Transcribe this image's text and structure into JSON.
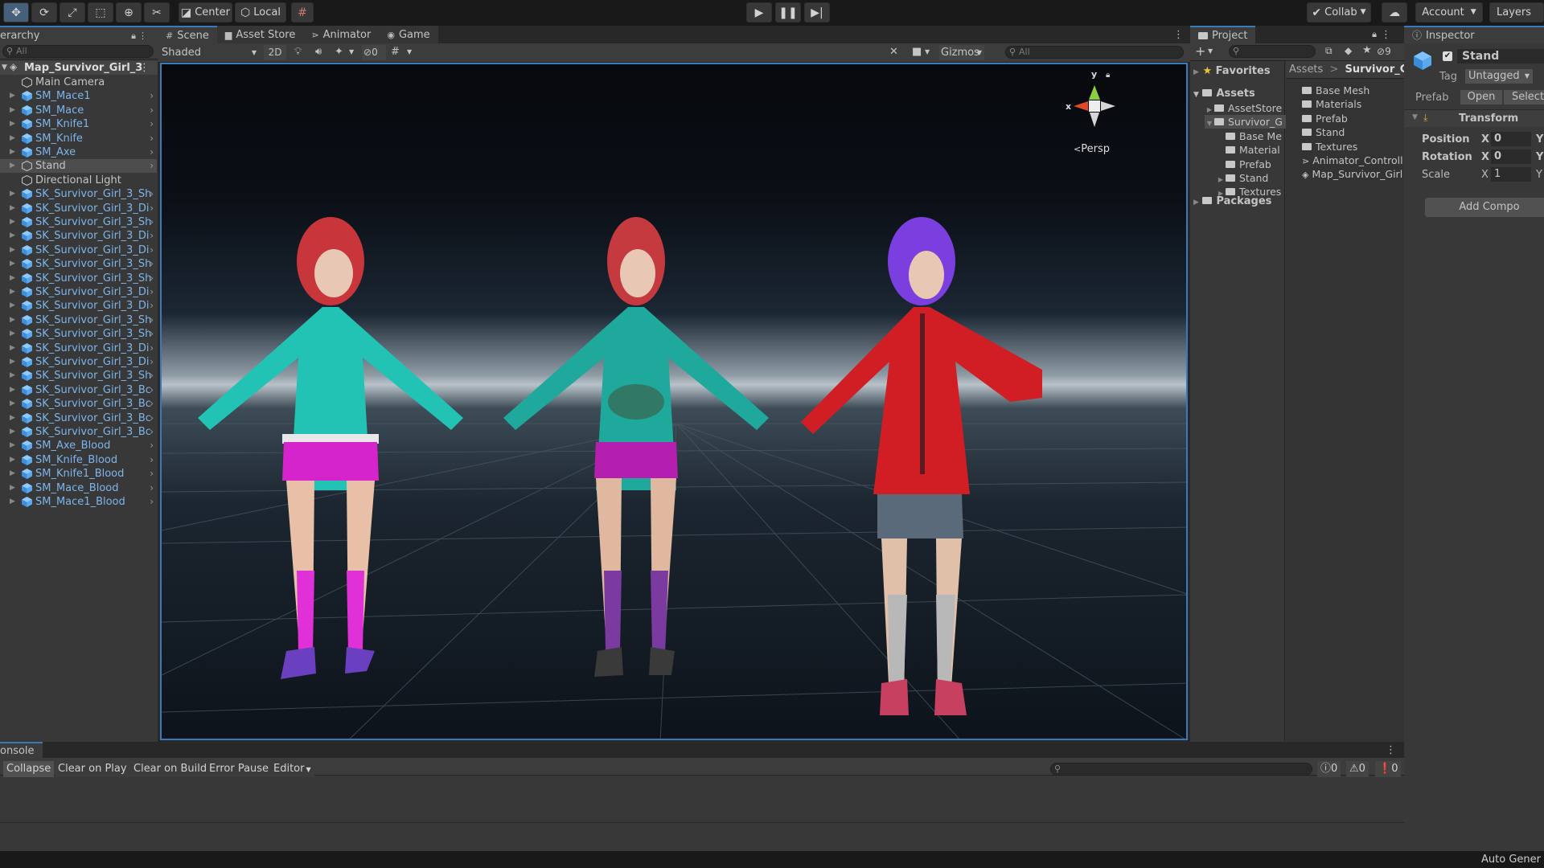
{
  "toolbar": {
    "pivot_label": "Center",
    "space_label": "Local",
    "collab_label": "Collab",
    "account_label": "Account",
    "layers_label": "Layers"
  },
  "hierarchy": {
    "tab": "erarchy",
    "search_placeholder": "All",
    "scene_name": "Map_Survivor_Girl_3",
    "items": [
      {
        "label": "Main Camera",
        "blue": false,
        "expand": false
      },
      {
        "label": "SM_Mace1",
        "blue": true,
        "expand": true
      },
      {
        "label": "SM_Mace",
        "blue": true,
        "expand": true
      },
      {
        "label": "SM_Knife1",
        "blue": true,
        "expand": true
      },
      {
        "label": "SM_Knife",
        "blue": true,
        "expand": true
      },
      {
        "label": "SM_Axe",
        "blue": true,
        "expand": true
      },
      {
        "label": "Stand",
        "blue": false,
        "expand": true
      },
      {
        "label": "Directional Light",
        "blue": false,
        "expand": false
      },
      {
        "label": "SK_Survivor_Girl_3_Sh",
        "blue": true,
        "expand": true
      },
      {
        "label": "SK_Survivor_Girl_3_Di",
        "blue": true,
        "expand": true
      },
      {
        "label": "SK_Survivor_Girl_3_Sh",
        "blue": true,
        "expand": true
      },
      {
        "label": "SK_Survivor_Girl_3_Di",
        "blue": true,
        "expand": true
      },
      {
        "label": "SK_Survivor_Girl_3_Di",
        "blue": true,
        "expand": true
      },
      {
        "label": "SK_Survivor_Girl_3_Sh",
        "blue": true,
        "expand": true
      },
      {
        "label": "SK_Survivor_Girl_3_Sh",
        "blue": true,
        "expand": true
      },
      {
        "label": "SK_Survivor_Girl_3_Di",
        "blue": true,
        "expand": true
      },
      {
        "label": "SK_Survivor_Girl_3_Di",
        "blue": true,
        "expand": true
      },
      {
        "label": "SK_Survivor_Girl_3_Sh",
        "blue": true,
        "expand": true
      },
      {
        "label": "SK_Survivor_Girl_3_Sh",
        "blue": true,
        "expand": true
      },
      {
        "label": "SK_Survivor_Girl_3_Di",
        "blue": true,
        "expand": true
      },
      {
        "label": "SK_Survivor_Girl_3_Di",
        "blue": true,
        "expand": true
      },
      {
        "label": "SK_Survivor_Girl_3_Sh",
        "blue": true,
        "expand": true
      },
      {
        "label": "SK_Survivor_Girl_3_Bc",
        "blue": true,
        "expand": true
      },
      {
        "label": "SK_Survivor_Girl_3_Bc",
        "blue": true,
        "expand": true
      },
      {
        "label": "SK_Survivor_Girl_3_Bc",
        "blue": true,
        "expand": true
      },
      {
        "label": "SK_Survivor_Girl_3_Bc",
        "blue": true,
        "expand": true
      },
      {
        "label": "SM_Axe_Blood",
        "blue": true,
        "expand": true
      },
      {
        "label": "SM_Knife_Blood",
        "blue": true,
        "expand": true
      },
      {
        "label": "SM_Knife1_Blood",
        "blue": true,
        "expand": true
      },
      {
        "label": "SM_Mace_Blood",
        "blue": true,
        "expand": true
      },
      {
        "label": "SM_Mace1_Blood",
        "blue": true,
        "expand": true
      }
    ]
  },
  "scene_view": {
    "tabs": [
      "Scene",
      "Asset Store",
      "Animator",
      "Game"
    ],
    "shading": "Shaded",
    "mode_2d": "2D",
    "hidden_count": "0",
    "gizmos_label": "Gizmos",
    "search_placeholder": "All",
    "persp_label": "Persp",
    "axis_x": "x",
    "axis_y": "y"
  },
  "project": {
    "tab": "Project",
    "favorites": "Favorites",
    "assets": "Assets",
    "packages": "Packages",
    "tree": [
      {
        "label": "AssetStore",
        "indent": 1,
        "open": false
      },
      {
        "label": "Survivor_G",
        "indent": 1,
        "open": true
      },
      {
        "label": "Base Me",
        "indent": 2,
        "open": null
      },
      {
        "label": "Material",
        "indent": 2,
        "open": null
      },
      {
        "label": "Prefab",
        "indent": 2,
        "open": null
      },
      {
        "label": "Stand",
        "indent": 2,
        "open": false
      },
      {
        "label": "Textures",
        "indent": 2,
        "open": false
      }
    ],
    "breadcrumb_root": "Assets",
    "breadcrumb_current": "Survivor_Girl",
    "files": [
      "Base Mesh",
      "Materials",
      "Prefab",
      "Stand",
      "Textures",
      "Animator_Controll",
      "Map_Survivor_Girl"
    ],
    "hidden_count": "9"
  },
  "inspector": {
    "tab": "Inspector",
    "object_name": "Stand",
    "tag_label": "Tag",
    "tag_value": "Untagged",
    "prefab_label": "Prefab",
    "open_label": "Open",
    "select_label": "Select",
    "component": "Transform",
    "position_label": "Position",
    "rotation_label": "Rotation",
    "scale_label": "Scale",
    "x": "X",
    "y": "Y",
    "position_x": "0",
    "rotation_x": "0",
    "scale_x": "1",
    "add_component": "Add Compo"
  },
  "console": {
    "tab": "onsole",
    "buttons": [
      "Collapse",
      "Clear on Play",
      "Clear on Build",
      "Error Pause",
      "Editor"
    ],
    "info_count": "0",
    "warn_count": "0",
    "error_count": "0"
  },
  "status": {
    "text": "Auto Gener"
  }
}
